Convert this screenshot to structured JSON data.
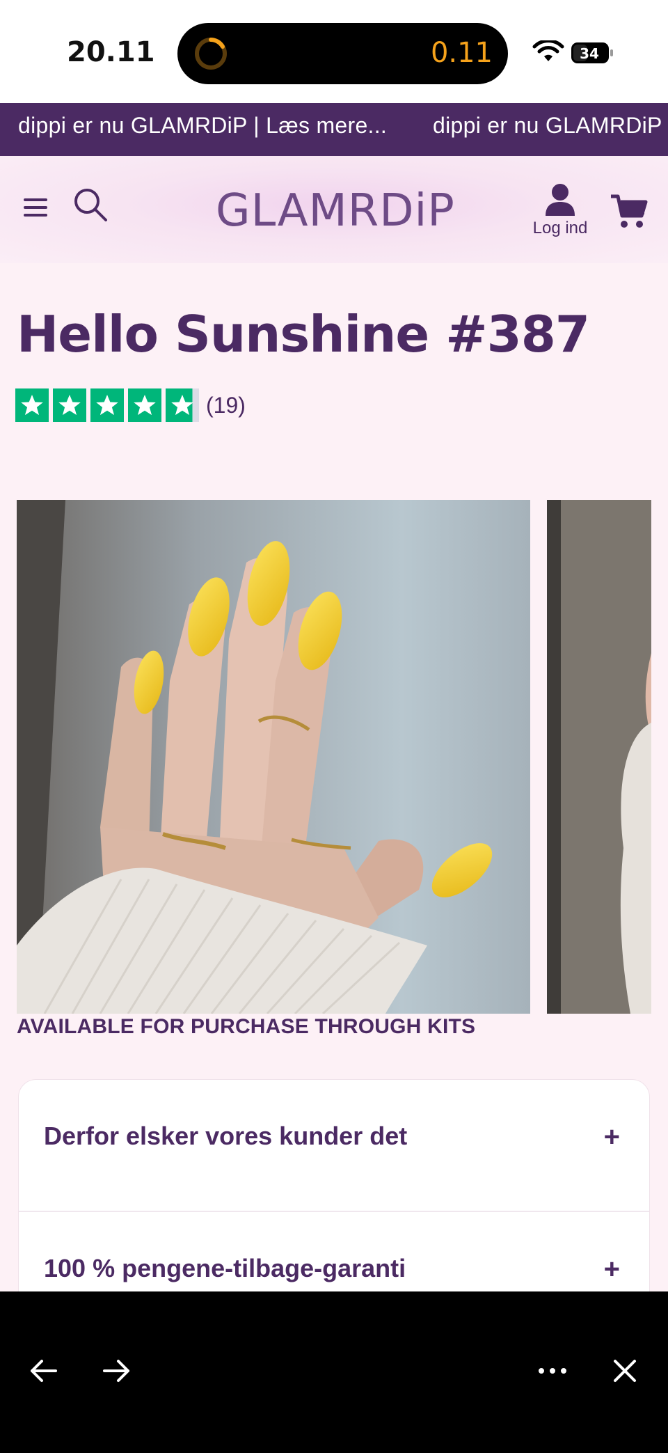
{
  "status": {
    "time": "20.11",
    "timer": "0.11",
    "battery": "34"
  },
  "announcement": {
    "text": "dippi er nu GLAMRDiP | Læs mere...",
    "text_repeat": "dippi er nu GLAMRDiP"
  },
  "header": {
    "logo": "GLAMRDiP",
    "account_label": "Log ind"
  },
  "product": {
    "title": "Hello Sunshine #387",
    "rating_stars": 4.8,
    "review_count": "(19)",
    "availability": "AVAILABLE FOR PURCHASE THROUGH KITS"
  },
  "accordion": [
    {
      "title": "Derfor elsker vores kunder det",
      "icon": "+"
    },
    {
      "title": "100 % pengene-tilbage-garanti",
      "icon": "+"
    }
  ],
  "colors": {
    "brand": "#4b2a63",
    "trustpilot_green": "#00b67a",
    "timer_orange": "#f5a21b"
  },
  "toolbar": {
    "icons": [
      "back-arrow-icon",
      "forward-arrow-icon",
      "more-icon",
      "close-icon"
    ]
  }
}
